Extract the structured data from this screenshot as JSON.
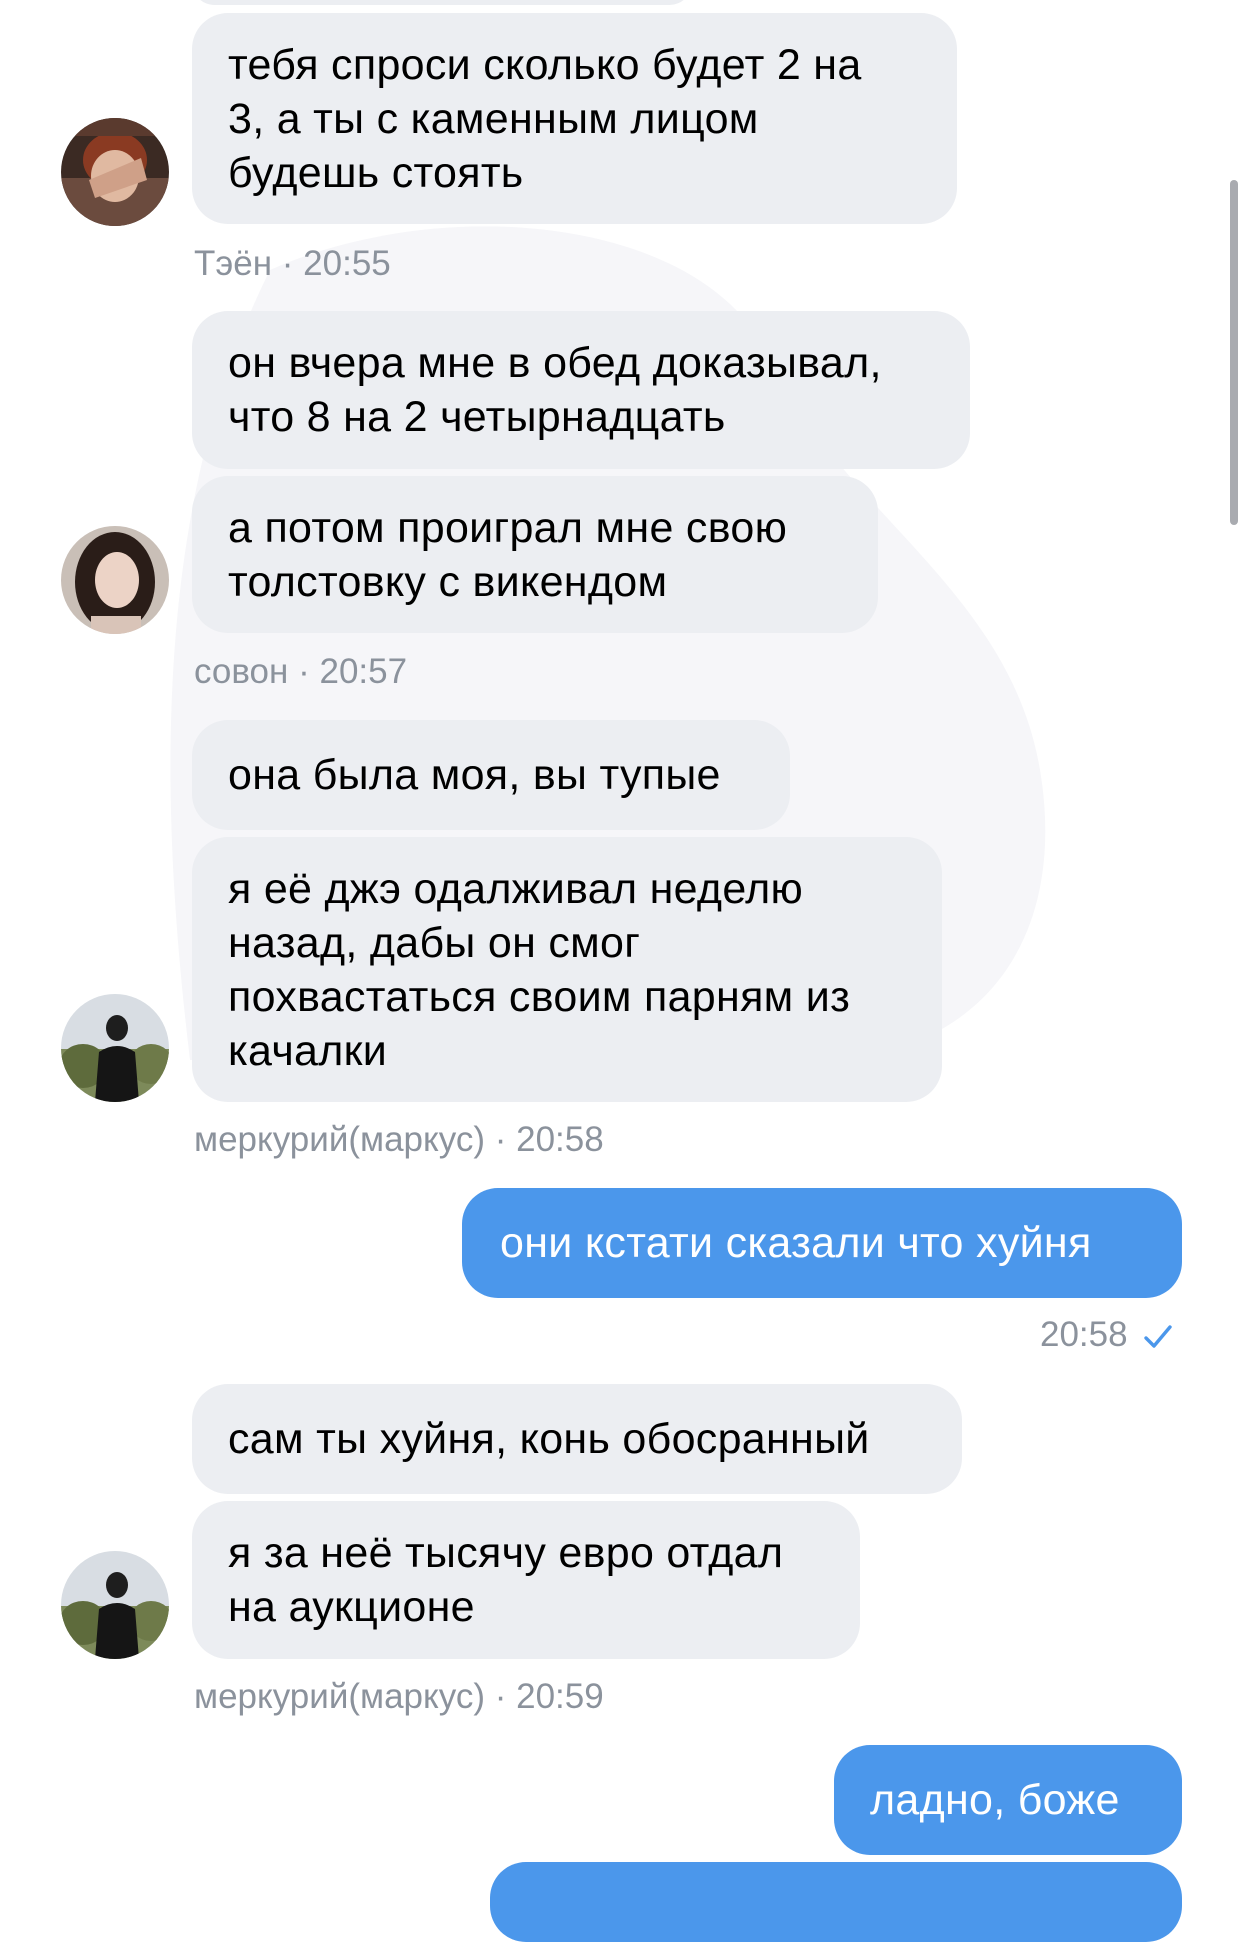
{
  "colors": {
    "incoming_bubble": "#eceef2",
    "outgoing_bubble": "#4b97eb",
    "meta_text": "#8b929c",
    "check": "#4b97eb"
  },
  "messages": [
    {
      "id": "m1",
      "sender": "Тэён",
      "text": "тебя спроси сколько будет 2 на\n3, а ты с каменным лицом\nбудешь стоять"
    },
    {
      "id": "m2",
      "sender": "совон",
      "text": "он вчера мне в обед доказывал,\nчто 8 на 2 четырнадцать"
    },
    {
      "id": "m3",
      "sender": "совон",
      "text": "а потом проиграл мне свою\nтолстовку с викендом"
    },
    {
      "id": "m4",
      "sender": "меркурий(маркус)",
      "text": "она была моя, вы тупые"
    },
    {
      "id": "m5",
      "sender": "меркурий(маркус)",
      "text": "я её джэ одалживал неделю\nназад, дабы он смог\nпохвастаться своим парням из\nкачалки"
    },
    {
      "id": "m6",
      "sender": "me",
      "text": "они кстати сказали что хуйня"
    },
    {
      "id": "m7",
      "sender": "меркурий(маркус)",
      "text": "сам ты хуйня, конь обосранный"
    },
    {
      "id": "m8",
      "sender": "меркурий(маркус)",
      "text": "я за неё тысячу евро отдал\nна аукционе"
    },
    {
      "id": "m9",
      "sender": "me",
      "text": "ладно, боже"
    }
  ],
  "meta": [
    {
      "id": "t1",
      "name": "Тэён",
      "time": "· 20:55"
    },
    {
      "id": "t2",
      "name": "совон",
      "time": "· 20:57"
    },
    {
      "id": "t3",
      "name": "меркурий(маркус)",
      "time": "· 20:58"
    },
    {
      "id": "t4",
      "name": "",
      "time": "20:58",
      "read_icon": "check-icon"
    },
    {
      "id": "t5",
      "name": "меркурий(маркус)",
      "time": "· 20:59"
    }
  ],
  "avatars": [
    {
      "id": "a1",
      "user": "Тэён",
      "icon": "avatar-photo"
    },
    {
      "id": "a2",
      "user": "совон",
      "icon": "avatar-photo"
    },
    {
      "id": "a3",
      "user": "меркурий(маркус)",
      "icon": "avatar-photo"
    },
    {
      "id": "a4",
      "user": "меркурий(маркус)",
      "icon": "avatar-photo"
    }
  ]
}
